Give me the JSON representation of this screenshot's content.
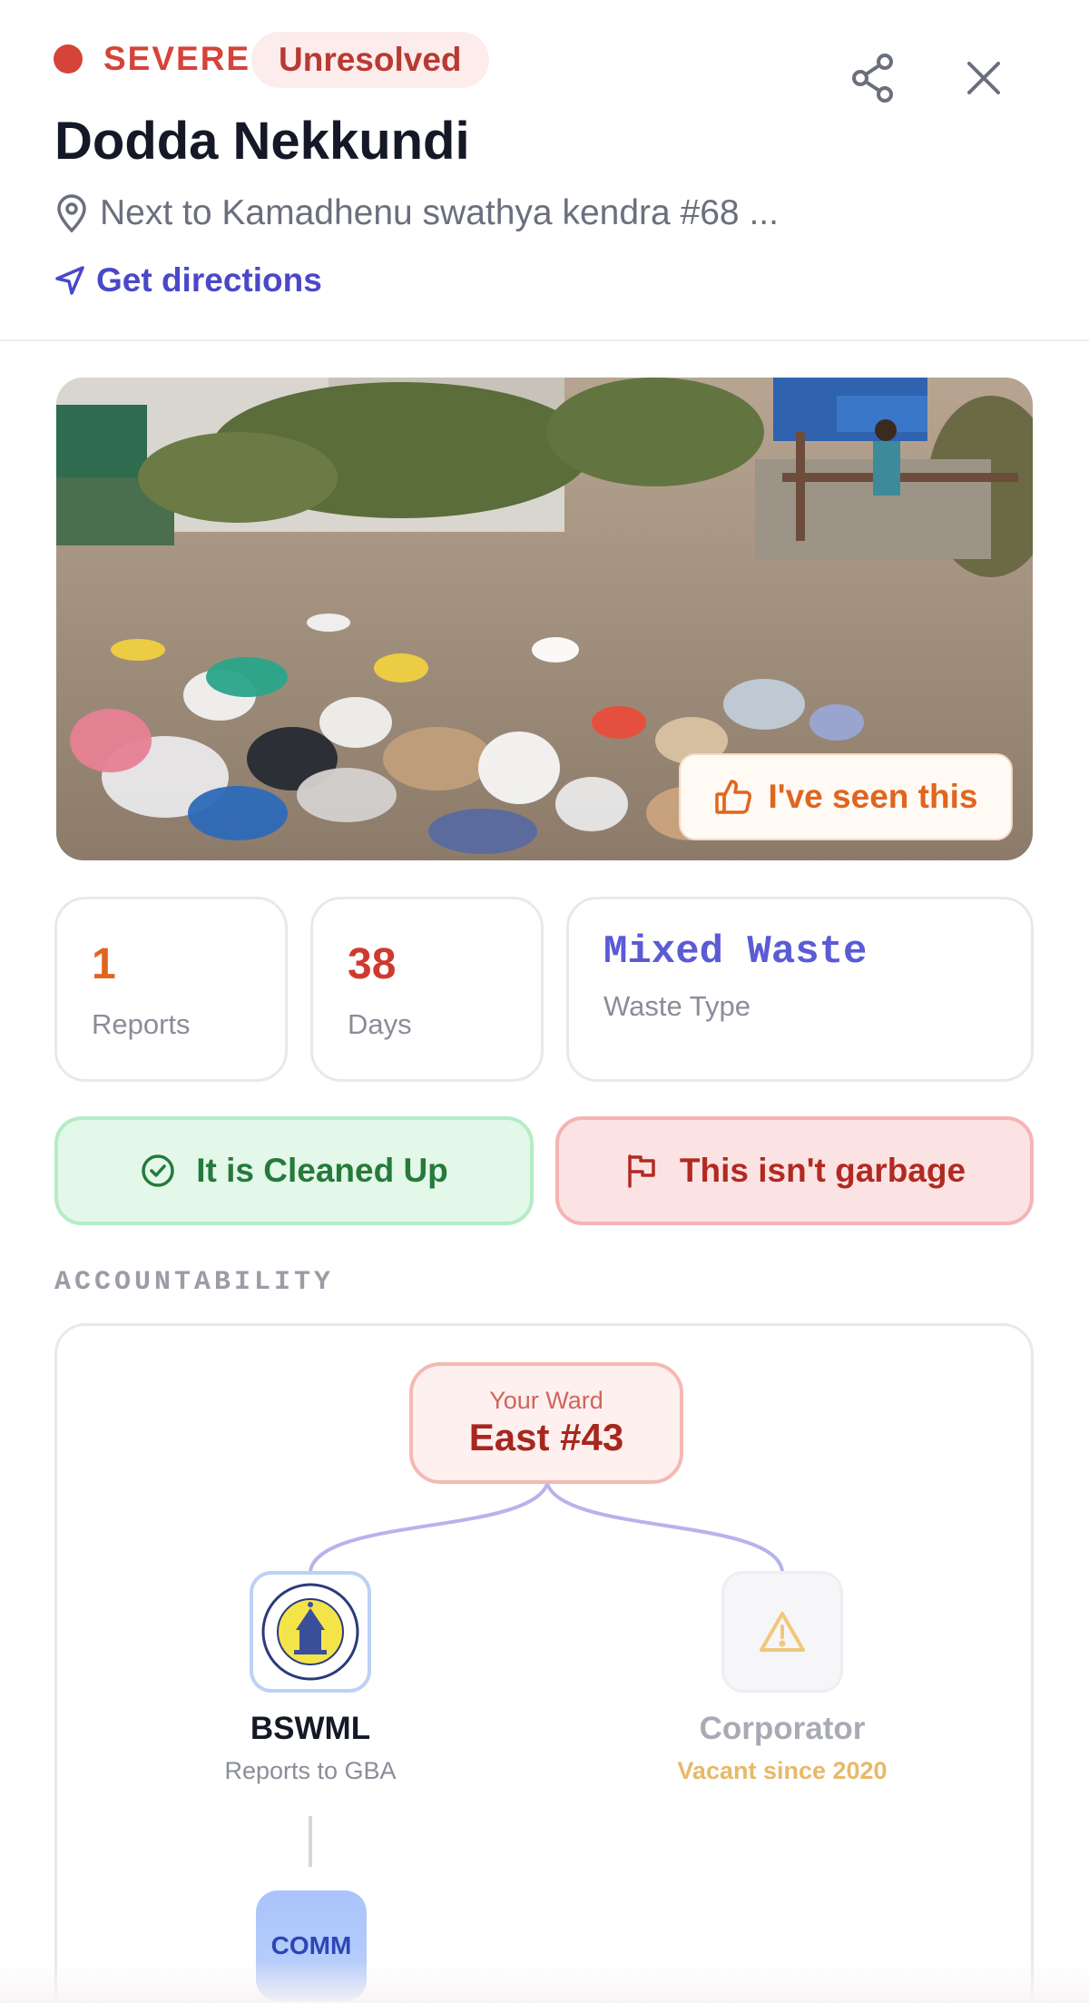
{
  "header": {
    "severity": "SEVERE",
    "status": "Unresolved",
    "title": "Dodda Nekkundi",
    "address": "Next to Kamadhenu swathya kendra #68 ...",
    "directions_label": "Get directions",
    "share_icon": "share-icon",
    "close_icon": "close-icon",
    "severity_color": "#d64339"
  },
  "photo": {
    "seen_label": "I've seen this"
  },
  "stats": [
    {
      "value": "1",
      "label": "Reports"
    },
    {
      "value": "38",
      "label": "Days"
    },
    {
      "value": "Mixed Waste",
      "label": "Waste Type"
    }
  ],
  "actions": {
    "cleaned_label": "It is Cleaned Up",
    "not_garbage_label": "This isn't garbage"
  },
  "accountability": {
    "section_label": "ACCOUNTABILITY",
    "ward_caption": "Your Ward",
    "ward_value": "East #43",
    "bswml": {
      "title": "BSWML",
      "subtitle": "Reports to GBA"
    },
    "corporator": {
      "title": "Corporator",
      "subtitle": "Vacant since 2020"
    },
    "child_label": "COMM"
  },
  "colors": {
    "accent": "#4a48c8",
    "orange": "#e0651e",
    "green": "#257a3c",
    "red": "#b12a22"
  }
}
